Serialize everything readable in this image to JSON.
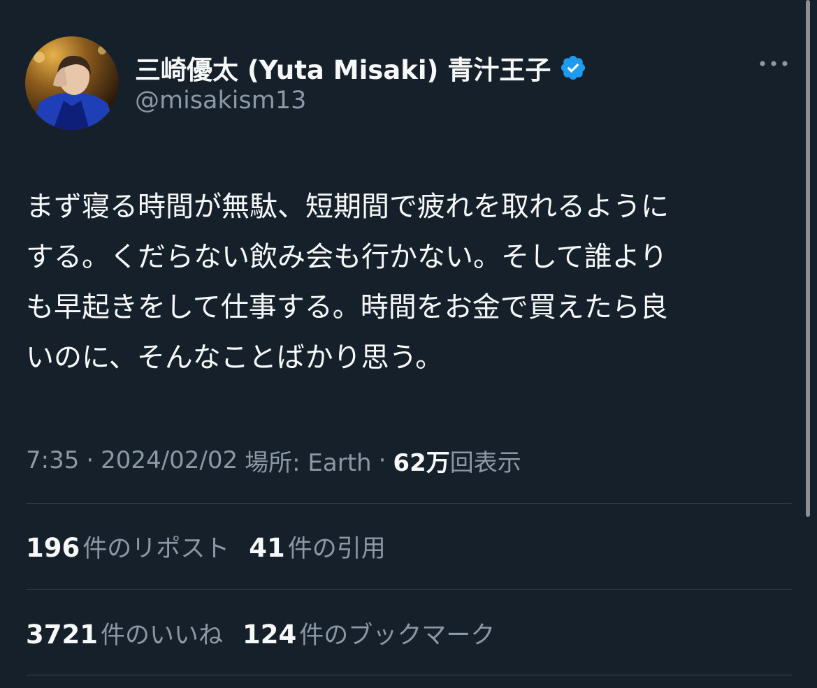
{
  "author": {
    "display_name": "三崎優太 (Yuta Misaki) 青汁王子",
    "handle": "@misakism13",
    "verified": true,
    "verified_color": "#1d9bf0"
  },
  "tweet": {
    "lines": [
      "まず寝る時間が無駄、短期間で疲れを取れるように",
      "する。くだらない飲み会も行かない。そして誰より",
      "も早起きをして仕事する。時間をお金で買えたら良",
      "いのに、そんなことばかり思う。"
    ],
    "time": "7:35",
    "date": "2024/02/02",
    "location": "場所: Earth",
    "views_count": "62万",
    "views_label": "回表示",
    "separator": "·"
  },
  "stats": {
    "reposts": {
      "count": "196",
      "label": "件のリポスト"
    },
    "quotes": {
      "count": "41",
      "label": "件の引用"
    },
    "likes": {
      "count": "3721",
      "label": "件のいいね"
    },
    "bookmarks": {
      "count": "124",
      "label": "件のブックマーク"
    }
  },
  "icons": {
    "more": "more-horizontal-icon",
    "verified": "verified-badge-icon"
  },
  "colors": {
    "background": "#15202b",
    "text_primary": "#f7f9f9",
    "text_secondary": "#8b98a5",
    "divider": "#38444d",
    "accent": "#1d9bf0"
  }
}
